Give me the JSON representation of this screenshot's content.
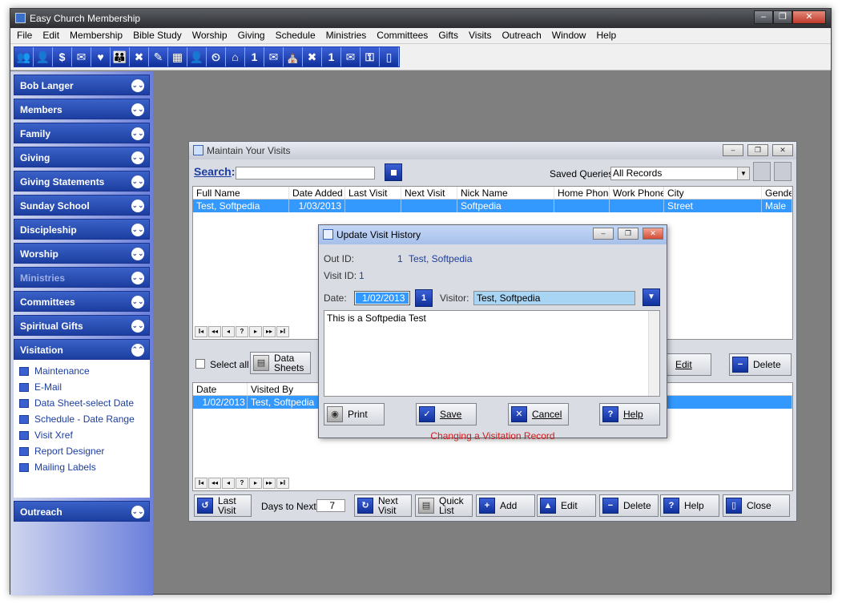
{
  "app": {
    "title": "Easy Church Membership"
  },
  "window_controls": {
    "minimize": "‒",
    "restore": "❐",
    "close": "✕"
  },
  "menu": [
    "File",
    "Edit",
    "Membership",
    "Bible Study",
    "Worship",
    "Giving",
    "Schedule",
    "Ministries",
    "Committees",
    "Gifts",
    "Visits",
    "Outreach",
    "Window",
    "Help"
  ],
  "toolbar_icons": [
    "members-icon",
    "family-icon",
    "giving-icon",
    "mail-icon",
    "heart-icon",
    "group-icon",
    "tools-icon",
    "pencil-icon",
    "calendar-grid-icon",
    "person-icon",
    "schedule-icon",
    "home-icon",
    "calendar-icon",
    "email-icon",
    "church-icon",
    "tools-icon",
    "calendar-icon",
    "email-icon",
    "key-icon",
    "exit-icon"
  ],
  "toolbar_glyphs": [
    "👥",
    "👤",
    "$",
    "✉",
    "♥",
    "👪",
    "✖",
    "✎",
    "▦",
    "👤",
    "⏲",
    "⌂",
    "1",
    "✉",
    "⛪",
    "✖",
    "1",
    "✉",
    "⚿",
    "▯"
  ],
  "sidebar": {
    "sections": [
      "Bob Langer",
      "Members",
      "Family",
      "Giving",
      "Giving Statements",
      "Sunday School",
      "Discipleship",
      "Worship",
      "Ministries",
      "Committees",
      "Spiritual Gifts"
    ],
    "active": "Visitation",
    "items": [
      "Maintenance",
      "E-Mail",
      "Data Sheet-select Date",
      "Schedule - Date Range",
      "Visit Xref",
      "Report Designer",
      "Mailing Labels"
    ],
    "last": "Outreach"
  },
  "maintain": {
    "title": "Maintain Your Visits",
    "search_label": "Search",
    "search_value": "",
    "saved_queries_label": "Saved Queries:",
    "saved_queries_value": "All Records",
    "columns": [
      "Full Name",
      "Date Added",
      "Last Visit",
      "Next Visit",
      "Nick Name",
      "Home Phone",
      "Work Phone",
      "City",
      "Gender"
    ],
    "rows": [
      [
        "Test, Softpedia",
        "1/03/2013",
        "",
        "",
        "Softpedia",
        "",
        "",
        "Street",
        "Male"
      ]
    ],
    "select_all": "Select all",
    "data_sheets": "Data Sheets",
    "edit": "Edit",
    "delete": "Delete",
    "sub_columns": [
      "Date",
      "Visited By"
    ],
    "sub_rows": [
      [
        "1/02/2013",
        "Test, Softpedia"
      ]
    ],
    "bottom": {
      "last_visit": "Last Visit",
      "days_to_next_label": "Days to Next:",
      "days_to_next": "7",
      "next_visit": "Next Visit",
      "quick_list": "Quick List",
      "add": "Add",
      "edit": "Edit",
      "delete": "Delete",
      "help": "Help",
      "close": "Close"
    },
    "nav": [
      "I◂",
      "◂◂",
      "◂",
      "?",
      "▸",
      "▸▸",
      "▸I"
    ]
  },
  "dialog": {
    "title": "Update Visit History",
    "out_id_label": "Out ID:",
    "out_id_value": "1",
    "out_id_name": "Test, Softpedia",
    "visit_id_label": "Visit ID:",
    "visit_id_value": "1",
    "date_label": "Date:",
    "date_value": "1/02/2013",
    "visitor_label": "Visitor:",
    "visitor_value": "Test, Softpedia",
    "note": "This is a Softpedia Test",
    "print": "Print",
    "save": "Save",
    "cancel": "Cancel",
    "help": "Help",
    "status": "Changing a Visitation Record"
  }
}
